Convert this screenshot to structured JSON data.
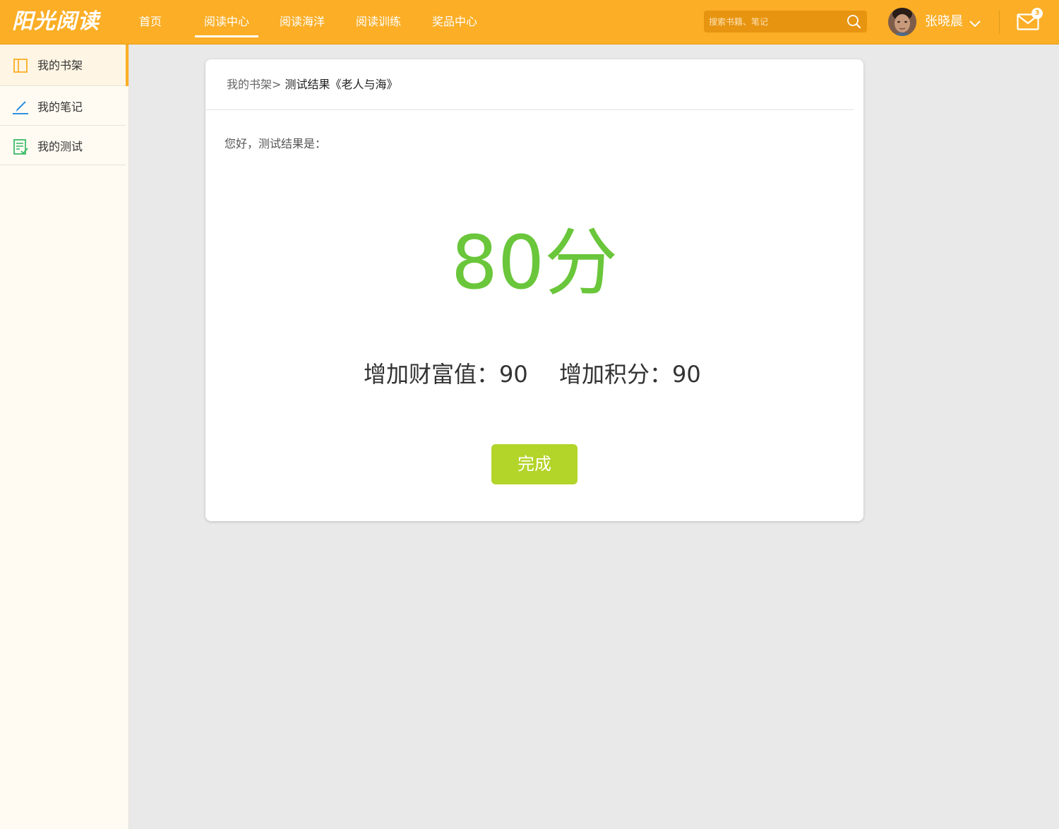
{
  "app": {
    "logo_text": "阳光阅读"
  },
  "nav": {
    "items": [
      {
        "label": "首页"
      },
      {
        "label": "阅读中心"
      },
      {
        "label": "阅读海洋"
      },
      {
        "label": "阅读训练"
      },
      {
        "label": "奖品中心"
      }
    ],
    "active_index": 1
  },
  "search": {
    "placeholder": "搜索书籍、笔记"
  },
  "user": {
    "name": "张晓晨"
  },
  "mail": {
    "unread_count": "3"
  },
  "sidebar": {
    "items": [
      {
        "label": "我的书架",
        "icon": "bookshelf-icon"
      },
      {
        "label": "我的笔记",
        "icon": "pencil-icon"
      },
      {
        "label": "我的测试",
        "icon": "test-icon"
      }
    ],
    "active_index": 0
  },
  "breadcrumb": {
    "parent": "我的书架>",
    "current": "测试结果《老人与海》"
  },
  "result": {
    "greeting": "您好，测试结果是：",
    "score": "80分",
    "wealth": "增加财富值：90",
    "points": "增加积分：90",
    "done_label": "完成"
  },
  "colors": {
    "topbar": "#fbae26",
    "score": "#6ac63a",
    "done_button": "#b3d429",
    "page_bg": "#e9e9e9",
    "sidebar_bg": "#fffbf2"
  }
}
